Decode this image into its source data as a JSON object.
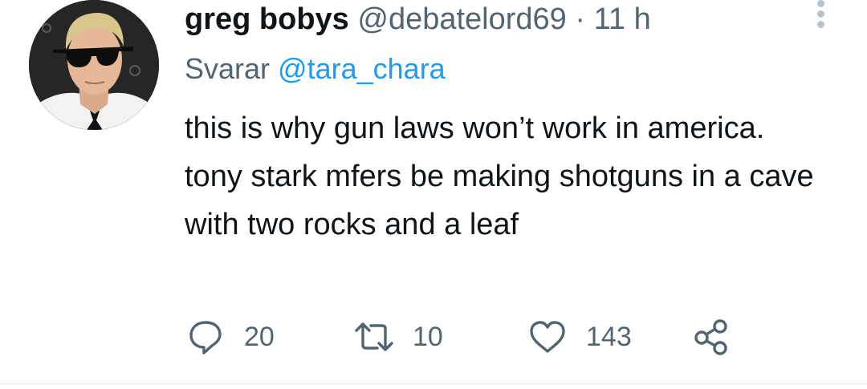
{
  "author": {
    "display_name": "greg bobys",
    "handle": "@debatelord69",
    "separator": "·",
    "time": "11 h"
  },
  "reply_context": {
    "prefix": "Svarar",
    "mention": "@tara_chara"
  },
  "tweet_text": "this is why gun laws won’t work in america. tony stark mfers be making shotguns in a cave with two rocks and a leaf",
  "actions": {
    "replies": "20",
    "retweets": "10",
    "likes": "143"
  },
  "icons": {
    "reply": "speech-bubble-icon",
    "retweet": "retweet-icon",
    "like": "heart-icon",
    "share": "share-nodes-icon",
    "more": "more-vertical-icon"
  },
  "colors": {
    "text": "#0f1419",
    "muted": "#536471",
    "accent": "#1d9bf0"
  }
}
